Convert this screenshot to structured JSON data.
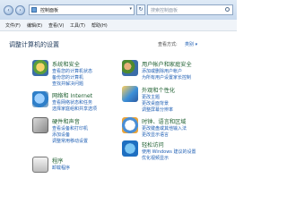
{
  "window": {
    "address": "控制面板",
    "search_placeholder": "搜索控制面板"
  },
  "menu": [
    "文件(F)",
    "编辑(E)",
    "查看(V)",
    "工具(T)",
    "帮助(H)"
  ],
  "main": {
    "heading": "调整计算机的设置",
    "view_by_label": "查看方式:",
    "view_by_value": "类别 ▾"
  },
  "categories": [
    {
      "title": "系统和安全",
      "links": [
        "查看您的计算机状态",
        "备份您的计算机",
        "查找并解决问题"
      ],
      "icon": "system-security-icon"
    },
    {
      "title": "网络和 Internet",
      "links": [
        "查看网络状态和任务",
        "选择家庭组和共享选项"
      ],
      "icon": "network-icon"
    },
    {
      "title": "硬件和声音",
      "links": [
        "查看设备和打印机",
        "添加设备",
        "调整常用移动设置"
      ],
      "icon": "hardware-sound-icon"
    },
    {
      "title": "程序",
      "links": [
        "卸载程序"
      ],
      "icon": "programs-icon"
    },
    {
      "title": "用户帐户和家庭安全",
      "links": [
        "添加或删除用户帐户",
        "为所有用户设置家长控制"
      ],
      "icon": "user-accounts-icon"
    },
    {
      "title": "外观和个性化",
      "links": [
        "更改主题",
        "更改桌面背景",
        "调整屏幕分辨率"
      ],
      "icon": "appearance-icon"
    },
    {
      "title": "时钟、语言和区域",
      "links": [
        "更改键盘或其他输入法",
        "更改显示语言"
      ],
      "icon": "clock-language-icon"
    },
    {
      "title": "轻松访问",
      "links": [
        "使用 Windows 建议的设置",
        "优化视频显示"
      ],
      "icon": "ease-of-access-icon"
    }
  ]
}
